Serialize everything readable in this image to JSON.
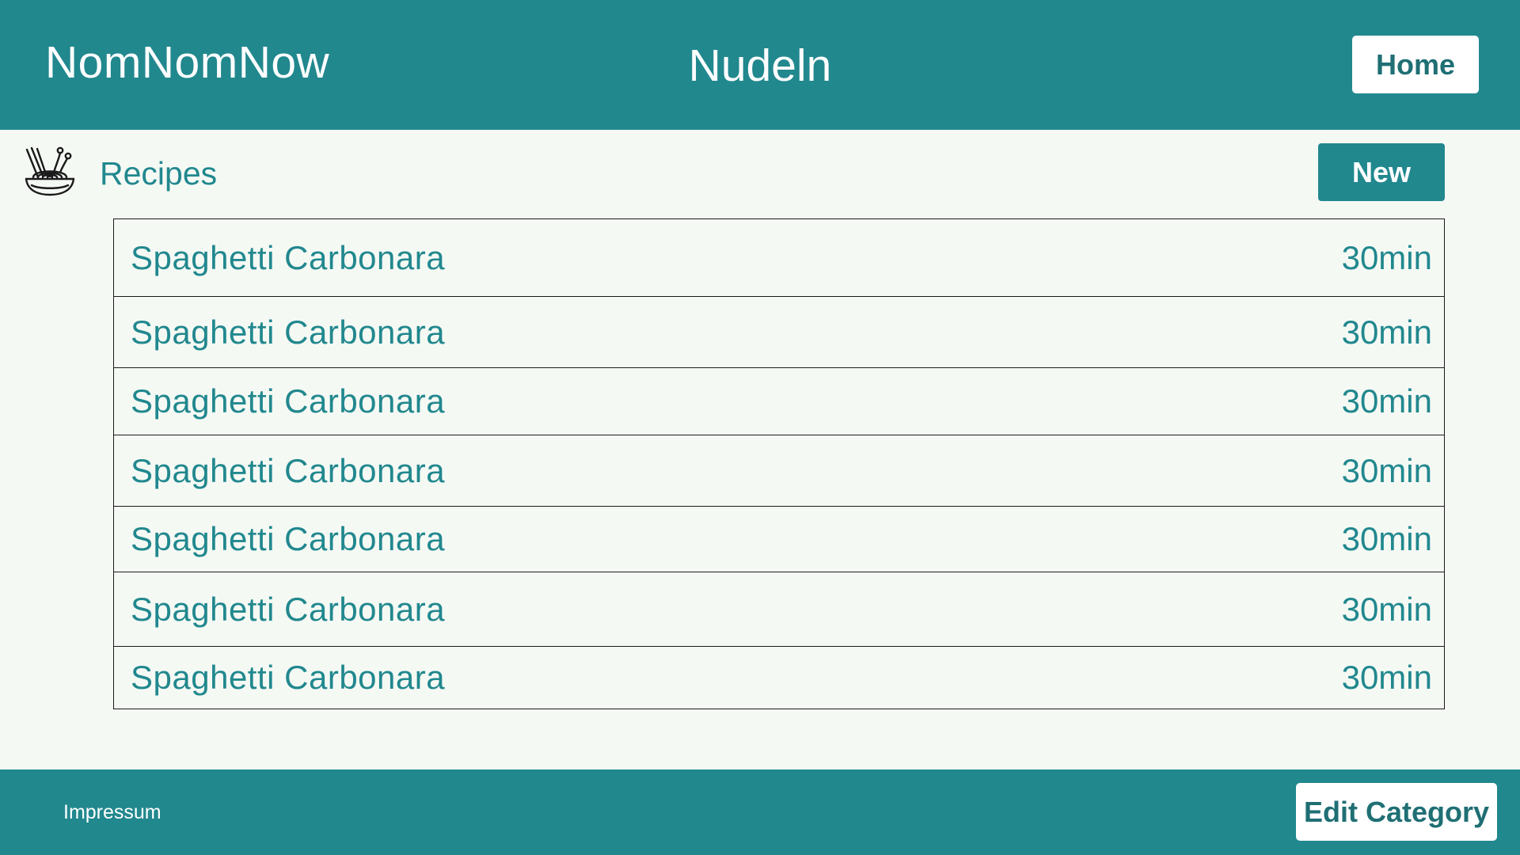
{
  "header": {
    "brand": "NomNomNow",
    "category_title": "Nudeln",
    "home_label": "Home"
  },
  "subheader": {
    "icon": "noodle-bowl-icon",
    "label": "Recipes",
    "new_label": "New"
  },
  "recipes": [
    {
      "name": "Spaghetti Carbonara",
      "time": "30min"
    },
    {
      "name": "Spaghetti Carbonara",
      "time": "30min"
    },
    {
      "name": "Spaghetti Carbonara",
      "time": "30min"
    },
    {
      "name": "Spaghetti Carbonara",
      "time": "30min"
    },
    {
      "name": "Spaghetti Carbonara",
      "time": "30min"
    },
    {
      "name": "Spaghetti Carbonara",
      "time": "30min"
    },
    {
      "name": "Spaghetti Carbonara",
      "time": "30min"
    }
  ],
  "footer": {
    "impressum_label": "Impressum",
    "edit_label": "Edit Category"
  },
  "colors": {
    "accent": "#21888e",
    "background": "#f5f9f4",
    "button_text": "#1f6f74"
  }
}
